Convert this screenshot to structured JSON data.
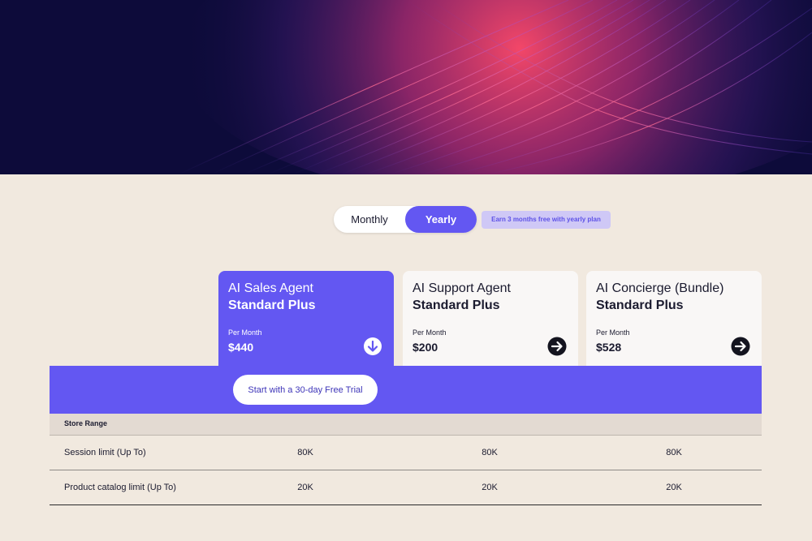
{
  "billing_toggle": {
    "monthly_label": "Monthly",
    "yearly_label": "Yearly",
    "selected": "Yearly"
  },
  "promo_badge": "Earn 3 months free with yearly plan",
  "plans": [
    {
      "name": "AI Sales Agent",
      "tier": "Standard Plus",
      "per_label": "Per Month",
      "price": "$440",
      "highlighted": true,
      "arrow_icon": "arrow-down-circle-icon"
    },
    {
      "name": "AI Support Agent",
      "tier": "Standard Plus",
      "per_label": "Per Month",
      "price": "$200",
      "highlighted": false,
      "arrow_icon": "arrow-right-circle-icon"
    },
    {
      "name": "AI Concierge (Bundle)",
      "tier": "Standard Plus",
      "per_label": "Per Month",
      "price": "$528",
      "highlighted": false,
      "arrow_icon": "arrow-right-circle-icon"
    }
  ],
  "cta": {
    "trial_label": "Start with a 30-day Free Trial"
  },
  "table": {
    "section_label": "Store Range",
    "rows": [
      {
        "label": "Session limit (Up To)",
        "values": [
          "80K",
          "80K",
          "80K"
        ]
      },
      {
        "label": "Product catalog limit (Up To)",
        "values": [
          "20K",
          "20K",
          "20K"
        ]
      }
    ]
  },
  "colors": {
    "accent": "#6357f2",
    "background": "#f1e9df",
    "hero": "#0d0b3a",
    "card": "#f9f7f6",
    "promo_bg": "#cfc8f6"
  }
}
